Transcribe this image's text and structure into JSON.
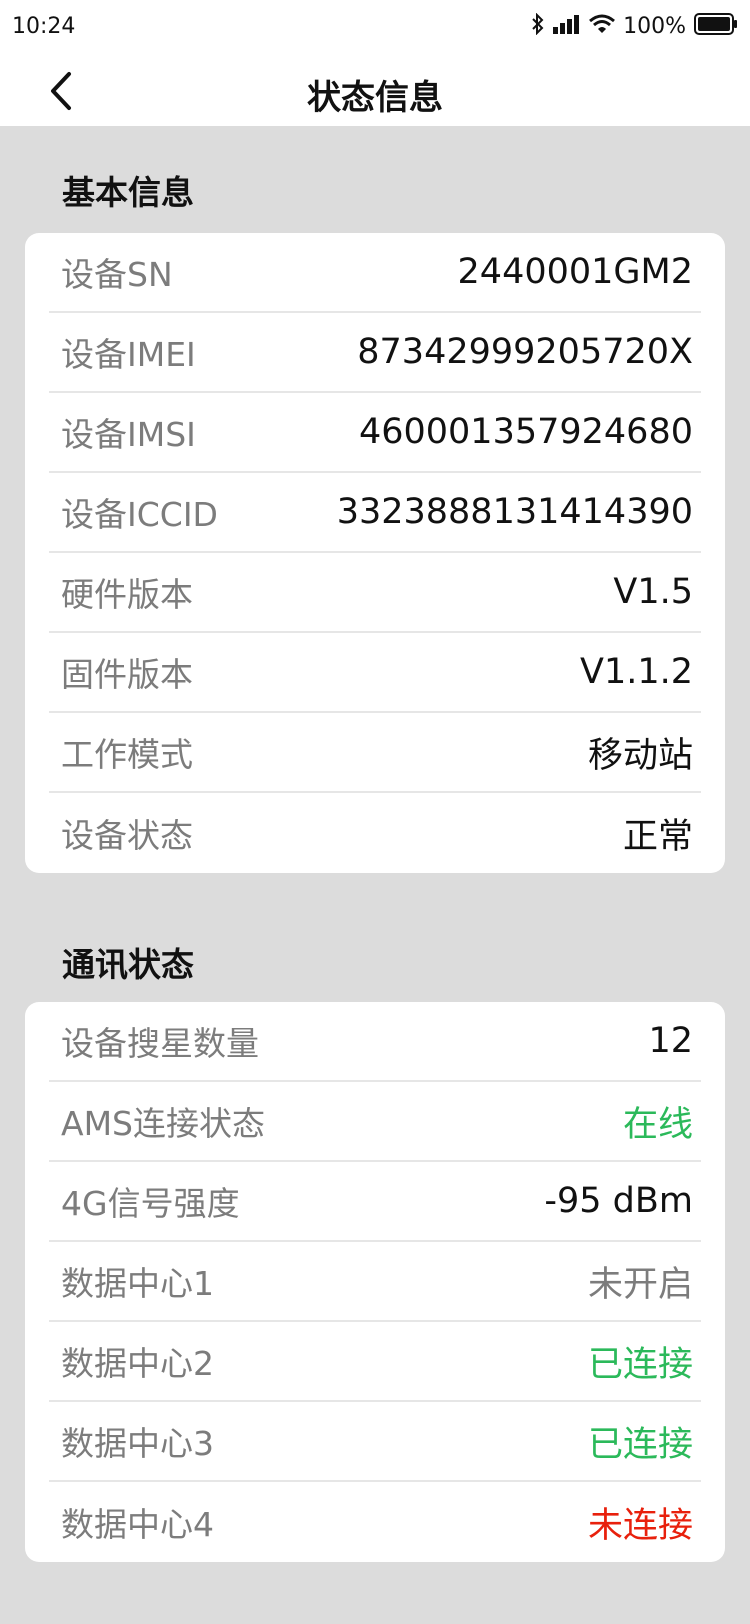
{
  "status_bar": {
    "time": "10:24",
    "battery_percent": "100%"
  },
  "nav": {
    "title": "状态信息"
  },
  "sections": [
    {
      "title": "基本信息",
      "rows": [
        {
          "label": "设备SN",
          "value": "2440001GM2",
          "color": "#111111"
        },
        {
          "label": "设备IMEI",
          "value": "87342999205720X",
          "color": "#111111"
        },
        {
          "label": "设备IMSI",
          "value": "460001357924680",
          "color": "#111111"
        },
        {
          "label": "设备ICCID",
          "value": "3323888131414390",
          "color": "#111111"
        },
        {
          "label": "硬件版本",
          "value": "V1.5",
          "color": "#111111"
        },
        {
          "label": "固件版本",
          "value": "V1.1.2",
          "color": "#111111"
        },
        {
          "label": "工作模式",
          "value": "移动站",
          "color": "#111111"
        },
        {
          "label": "设备状态",
          "value": "正常",
          "color": "#111111"
        }
      ]
    },
    {
      "title": "通讯状态",
      "rows": [
        {
          "label": "设备搜星数量",
          "value": "12",
          "color": "#111111"
        },
        {
          "label": "AMS连接状态",
          "value": "在线",
          "color": "#2bb95a"
        },
        {
          "label": "4G信号强度",
          "value": "-95 dBm",
          "color": "#111111"
        },
        {
          "label": "数据中心1",
          "value": "未开启",
          "color": "#7c7c7c"
        },
        {
          "label": "数据中心2",
          "value": "已连接",
          "color": "#2bb95a"
        },
        {
          "label": "数据中心3",
          "value": "已连接",
          "color": "#2bb95a"
        },
        {
          "label": "数据中心4",
          "value": "未连接",
          "color": "#e8200c"
        }
      ]
    }
  ],
  "icons": {
    "back": "chevron-left-icon",
    "bluetooth": "bluetooth-icon",
    "signal": "cellular-signal-icon",
    "wifi": "wifi-icon",
    "battery": "battery-icon"
  }
}
